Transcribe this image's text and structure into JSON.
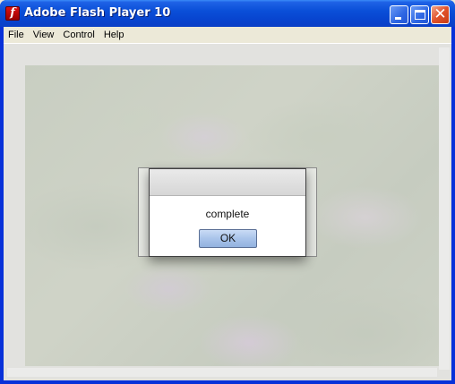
{
  "window": {
    "title": "Adobe Flash Player 10",
    "icon": "flash-icon"
  },
  "menubar": {
    "items": [
      "File",
      "View",
      "Control",
      "Help"
    ]
  },
  "dialog": {
    "message": "complete",
    "ok_label": "OK"
  },
  "colors": {
    "titlebar": "#0a4fd8",
    "close_button": "#e0522a",
    "dialog_header": "#d6d6d6",
    "ok_button": "#a9c4ea"
  }
}
